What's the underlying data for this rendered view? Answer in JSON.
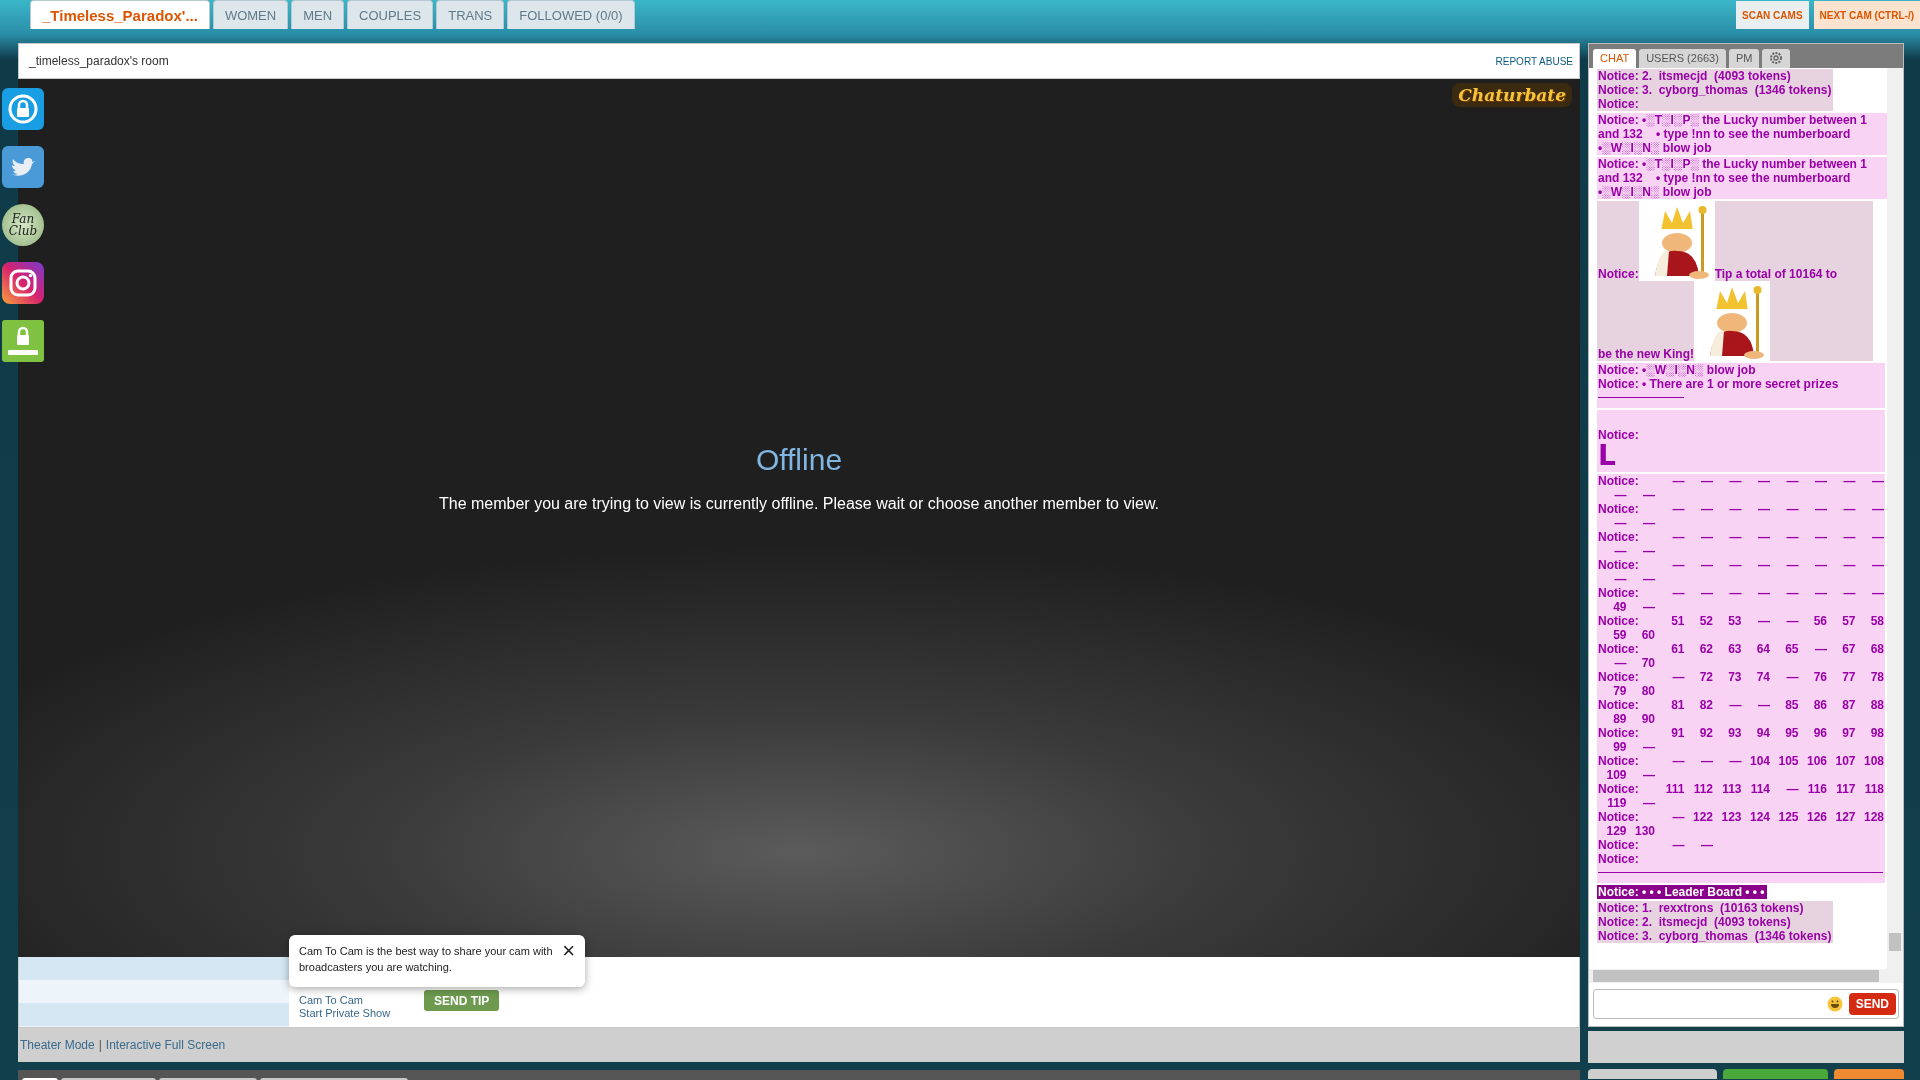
{
  "top_tabs": [
    {
      "label": "_Timeless_Paradox'...",
      "selected": true
    },
    {
      "label": "WOMEN",
      "selected": false
    },
    {
      "label": "MEN",
      "selected": false
    },
    {
      "label": "COUPLES",
      "selected": false
    },
    {
      "label": "TRANS",
      "selected": false
    },
    {
      "label": "FOLLOWED (0/0)",
      "selected": false
    }
  ],
  "top_links": [
    {
      "label": "SCAN CAMS",
      "kind": "link"
    },
    {
      "label": "NEXT CAM (CTRL-/)",
      "kind": "button"
    }
  ],
  "side_links": [
    {
      "kind": "lock"
    },
    {
      "kind": "twitter"
    },
    {
      "kind": "fanclub",
      "label": "Fan Club"
    },
    {
      "kind": "instagram"
    },
    {
      "kind": "dmca"
    }
  ],
  "room": {
    "title": "_timeless_paradox's room",
    "report": "REPORT ABUSE",
    "logo": "Chaturbate",
    "status": "Offline",
    "message": "The member you are trying to view is currently offline. Please wait or choose another member to view."
  },
  "actions": {
    "links": [
      "Cam To Cam",
      "Start Private Show"
    ],
    "tip_button": "SEND TIP"
  },
  "tooltip": {
    "text": "Cam To Cam is the best way to share your cam with broadcasters you are watching.",
    "close": "×"
  },
  "view_links": [
    "Theater Mode",
    "|",
    "Interactive Full Screen"
  ],
  "chat_tabs": [
    {
      "label": "CHAT",
      "selected": true,
      "kind": "text"
    },
    {
      "label": "USERS (2663)",
      "selected": false,
      "kind": "text"
    },
    {
      "label": "PM",
      "selected": false,
      "kind": "text"
    },
    {
      "selected": false,
      "kind": "gear"
    }
  ],
  "messages": [
    {
      "kind": "text",
      "color": "#e6d3df",
      "lines": [
        "Notice: 2.  itsmecjd  (4093 tokens)",
        "Notice: 3.  cyborg_thomas  (1346 tokens)",
        "Notice:"
      ]
    },
    {
      "kind": "text",
      "color": "#f9d3f3",
      "lines": [
        "Notice: •░T░I░P░ the Lucky number between 1 and 132    • type !nn to see the numberboard    •░W░I░N░ blow job"
      ]
    },
    {
      "kind": "text",
      "color": "#f9d3f3",
      "lines": [
        "Notice: •░T░I░P░ the Lucky number between 1 and 132    • type !nn to see the numberboard    •░W░I░N░ blow job"
      ]
    },
    {
      "kind": "king",
      "color": "#e6d3df",
      "parts": [
        "Notice:",
        "Tip a total of 10164 to",
        "be the new King!"
      ]
    },
    {
      "kind": "text",
      "color": "#f9d3f3",
      "lines": [
        "Notice: •░W░I░N░ blow job",
        "Notice: • There are 1 or more secret prizes"
      ],
      "divider": true
    },
    {
      "kind": "glyph",
      "color": "#f9d3f3",
      "label": "Notice:",
      "glyph": "L"
    },
    {
      "kind": "board",
      "color": "#f9d3f3",
      "rows": [
        {
          "label": "Notice:",
          "cells": [
            "—",
            "—",
            "—",
            "—",
            "—",
            "—",
            "—",
            "—",
            "—",
            "—"
          ]
        },
        {
          "label": "Notice:",
          "cells": [
            "—",
            "—",
            "—",
            "—",
            "—",
            "—",
            "—",
            "—",
            "—",
            "—"
          ]
        },
        {
          "label": "Notice:",
          "cells": [
            "—",
            "—",
            "—",
            "—",
            "—",
            "—",
            "—",
            "—",
            "—",
            "—"
          ]
        },
        {
          "label": "Notice:",
          "cells": [
            "—",
            "—",
            "—",
            "—",
            "—",
            "—",
            "—",
            "—",
            "—",
            "—"
          ]
        },
        {
          "label": "Notice:",
          "cells": [
            "—",
            "—",
            "—",
            "—",
            "—",
            "—",
            "—",
            "—",
            "49",
            "—"
          ]
        },
        {
          "label": "Notice:",
          "cells": [
            "51",
            "52",
            "53",
            "—",
            "—",
            "56",
            "57",
            "58",
            "59",
            "60"
          ]
        },
        {
          "label": "Notice:",
          "cells": [
            "61",
            "62",
            "63",
            "64",
            "65",
            "—",
            "67",
            "68",
            "—",
            "70"
          ]
        },
        {
          "label": "Notice:",
          "cells": [
            "—",
            "72",
            "73",
            "74",
            "—",
            "76",
            "77",
            "78",
            "79",
            "80"
          ]
        },
        {
          "label": "Notice:",
          "cells": [
            "81",
            "82",
            "—",
            "—",
            "85",
            "86",
            "87",
            "88",
            "89",
            "90"
          ]
        },
        {
          "label": "Notice:",
          "cells": [
            "91",
            "92",
            "93",
            "94",
            "95",
            "96",
            "97",
            "98",
            "99",
            "—"
          ]
        },
        {
          "label": "Notice:",
          "cells": [
            "—",
            "—",
            "—",
            "104",
            "105",
            "106",
            "107",
            "108",
            "109",
            "—"
          ]
        },
        {
          "label": "Notice:",
          "cells": [
            "111",
            "112",
            "113",
            "114",
            "—",
            "116",
            "117",
            "118",
            "119",
            "—"
          ]
        },
        {
          "label": "Notice:",
          "cells": [
            "—",
            "122",
            "123",
            "124",
            "125",
            "126",
            "127",
            "128",
            "129",
            "130"
          ]
        },
        {
          "label": "Notice:",
          "cells": [
            "—",
            "—"
          ]
        },
        {
          "label": "Notice:"
        }
      ],
      "divider": true
    },
    {
      "kind": "header",
      "color": "#8a008a",
      "lines": [
        "Notice: • • • Leader Board • • •"
      ]
    },
    {
      "kind": "text",
      "color": "#e6d3df",
      "lines": [
        "Notice: 1.  rexxtrons  (10163 tokens)",
        "Notice: 2.  itsmecjd  (4093 tokens)",
        "Notice: 3.  cyborg_thomas  (1346 tokens)"
      ]
    }
  ],
  "chat_input": {
    "send": "SEND"
  }
}
